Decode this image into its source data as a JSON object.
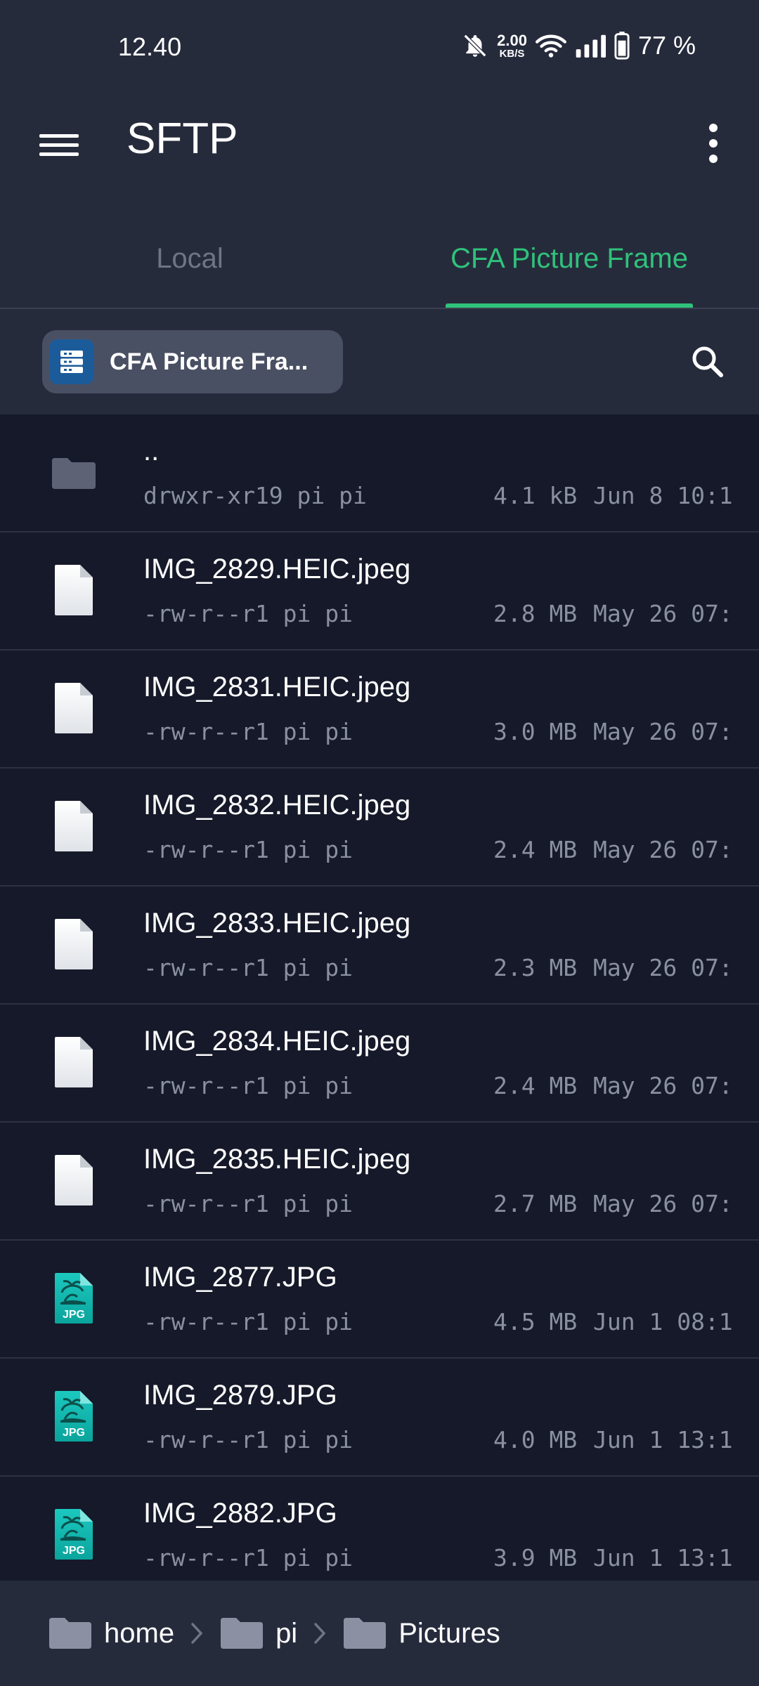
{
  "status_bar": {
    "time": "12.40",
    "net_speed_value": "2.00",
    "net_speed_unit": "KB/S",
    "battery": "77 %"
  },
  "app_bar": {
    "title": "SFTP"
  },
  "tabs": [
    {
      "label": "Local",
      "active": false
    },
    {
      "label": "CFA Picture Frame",
      "active": true
    }
  ],
  "toolbar": {
    "host_label": "CFA Picture Fra..."
  },
  "files": [
    {
      "name": "..",
      "perm": "drwxr-xr19 pi pi",
      "size": "4.1 kB",
      "date": "Jun 8 10:1",
      "icon": "folder-icon"
    },
    {
      "name": "IMG_2829.HEIC.jpeg",
      "perm": "-rw-r--r1 pi pi",
      "size": "2.8 MB",
      "date": "May 26 07:",
      "icon": "file-icon"
    },
    {
      "name": "IMG_2831.HEIC.jpeg",
      "perm": "-rw-r--r1 pi pi",
      "size": "3.0 MB",
      "date": "May 26 07:",
      "icon": "file-icon"
    },
    {
      "name": "IMG_2832.HEIC.jpeg",
      "perm": "-rw-r--r1 pi pi",
      "size": "2.4 MB",
      "date": "May 26 07:",
      "icon": "file-icon"
    },
    {
      "name": "IMG_2833.HEIC.jpeg",
      "perm": "-rw-r--r1 pi pi",
      "size": "2.3 MB",
      "date": "May 26 07:",
      "icon": "file-icon"
    },
    {
      "name": "IMG_2834.HEIC.jpeg",
      "perm": "-rw-r--r1 pi pi",
      "size": "2.4 MB",
      "date": "May 26 07:",
      "icon": "file-icon"
    },
    {
      "name": "IMG_2835.HEIC.jpeg",
      "perm": "-rw-r--r1 pi pi",
      "size": "2.7 MB",
      "date": "May 26 07:",
      "icon": "file-icon"
    },
    {
      "name": "IMG_2877.JPG",
      "perm": "-rw-r--r1 pi pi",
      "size": "4.5 MB",
      "date": "Jun 1 08:1",
      "icon": "jpg-file-icon"
    },
    {
      "name": "IMG_2879.JPG",
      "perm": "-rw-r--r1 pi pi",
      "size": "4.0 MB",
      "date": "Jun 1 13:1",
      "icon": "jpg-file-icon"
    },
    {
      "name": "IMG_2882.JPG",
      "perm": "-rw-r--r1 pi pi",
      "size": "3.9 MB",
      "date": "Jun 1 13:1",
      "icon": "jpg-file-icon"
    }
  ],
  "jpg_badge": "JPG",
  "breadcrumb": [
    {
      "label": "home"
    },
    {
      "label": "pi"
    },
    {
      "label": "Pictures"
    }
  ],
  "colors": {
    "background": "#151929",
    "header": "#262b3c",
    "accent": "#2fc27a",
    "meta_text": "#8a90a0"
  }
}
